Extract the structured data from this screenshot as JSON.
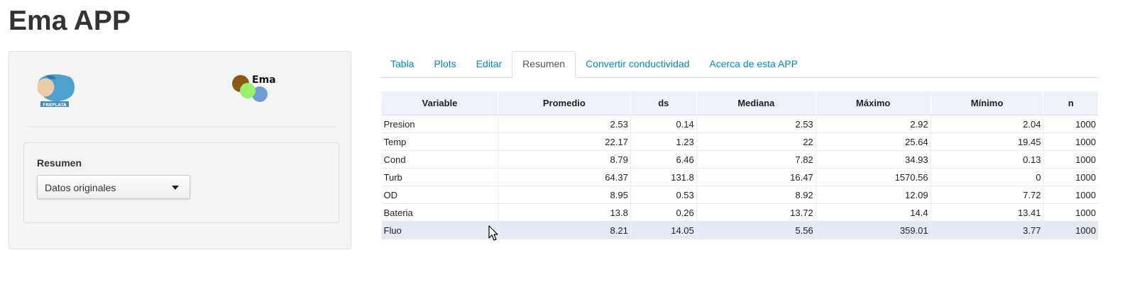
{
  "app": {
    "title": "Ema APP"
  },
  "sidebar": {
    "logos": {
      "left_text": "FREPLATA",
      "right_text": "Ema"
    },
    "control_label": "Resumen",
    "select_value": "Datos originales"
  },
  "tabs": [
    {
      "label": "Tabla",
      "active": false
    },
    {
      "label": "Plots",
      "active": false
    },
    {
      "label": "Editar",
      "active": false
    },
    {
      "label": "Resumen",
      "active": true
    },
    {
      "label": "Convertir conductividad",
      "active": false
    },
    {
      "label": "Acerca de esta APP",
      "active": false
    }
  ],
  "table": {
    "headers": [
      "Variable",
      "Promedio",
      "ds",
      "Mediana",
      "Máximo",
      "Mínimo",
      "n"
    ],
    "rows": [
      [
        "Presion",
        "2.53",
        "0.14",
        "2.53",
        "2.92",
        "2.04",
        "1000"
      ],
      [
        "Temp",
        "22.17",
        "1.23",
        "22",
        "25.64",
        "19.45",
        "1000"
      ],
      [
        "Cond",
        "8.79",
        "6.46",
        "7.82",
        "34.93",
        "0.13",
        "1000"
      ],
      [
        "Turb",
        "64.37",
        "131.8",
        "16.47",
        "1570.56",
        "0",
        "1000"
      ],
      [
        "OD",
        "8.95",
        "0.53",
        "8.92",
        "12.09",
        "7.72",
        "1000"
      ],
      [
        "Bateria",
        "13.8",
        "0.26",
        "13.72",
        "14.4",
        "13.41",
        "1000"
      ],
      [
        "Fluo",
        "8.21",
        "14.05",
        "5.56",
        "359.01",
        "3.77",
        "1000"
      ]
    ],
    "hover_row_index": 6
  },
  "colors": {
    "link": "#0089c8",
    "header_bg": "#edf2f8",
    "hover_row_bg": "#e5e8f5",
    "sidebar_bg": "#f4f4f4"
  }
}
